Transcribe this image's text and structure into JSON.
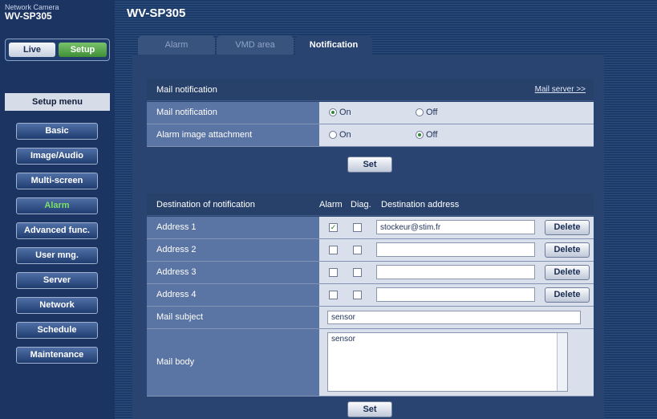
{
  "brand": {
    "small": "Network Camera",
    "model": "WV-SP305"
  },
  "title": "WV-SP305",
  "mode": {
    "live": "Live",
    "setup": "Setup"
  },
  "setup_menu_label": "Setup menu",
  "menu": [
    "Basic",
    "Image/Audio",
    "Multi-screen",
    "Alarm",
    "Advanced func.",
    "User mng.",
    "Server",
    "Network",
    "Schedule",
    "Maintenance"
  ],
  "tabs": [
    "Alarm",
    "VMD area",
    "Notification"
  ],
  "mail_section": {
    "title": "Mail notification",
    "server_link": "Mail server >>",
    "rows": [
      {
        "label": "Mail notification",
        "on": "On",
        "off": "Off",
        "selected": "On"
      },
      {
        "label": "Alarm image attachment",
        "on": "On",
        "off": "Off",
        "selected": "Off"
      }
    ],
    "set_label": "Set"
  },
  "dest_section": {
    "title": "Destination of notification",
    "col_alarm": "Alarm",
    "col_diag": "Diag.",
    "col_address": "Destination address",
    "addresses": [
      {
        "label": "Address 1",
        "alarm": true,
        "diag": false,
        "value": "stockeur@stim.fr"
      },
      {
        "label": "Address 2",
        "alarm": false,
        "diag": false,
        "value": ""
      },
      {
        "label": "Address 3",
        "alarm": false,
        "diag": false,
        "value": ""
      },
      {
        "label": "Address 4",
        "alarm": false,
        "diag": false,
        "value": ""
      }
    ],
    "delete_label": "Delete",
    "subject_label": "Mail subject",
    "subject_value": "sensor",
    "body_label": "Mail body",
    "body_value": "sensor",
    "set_label": "Set"
  }
}
